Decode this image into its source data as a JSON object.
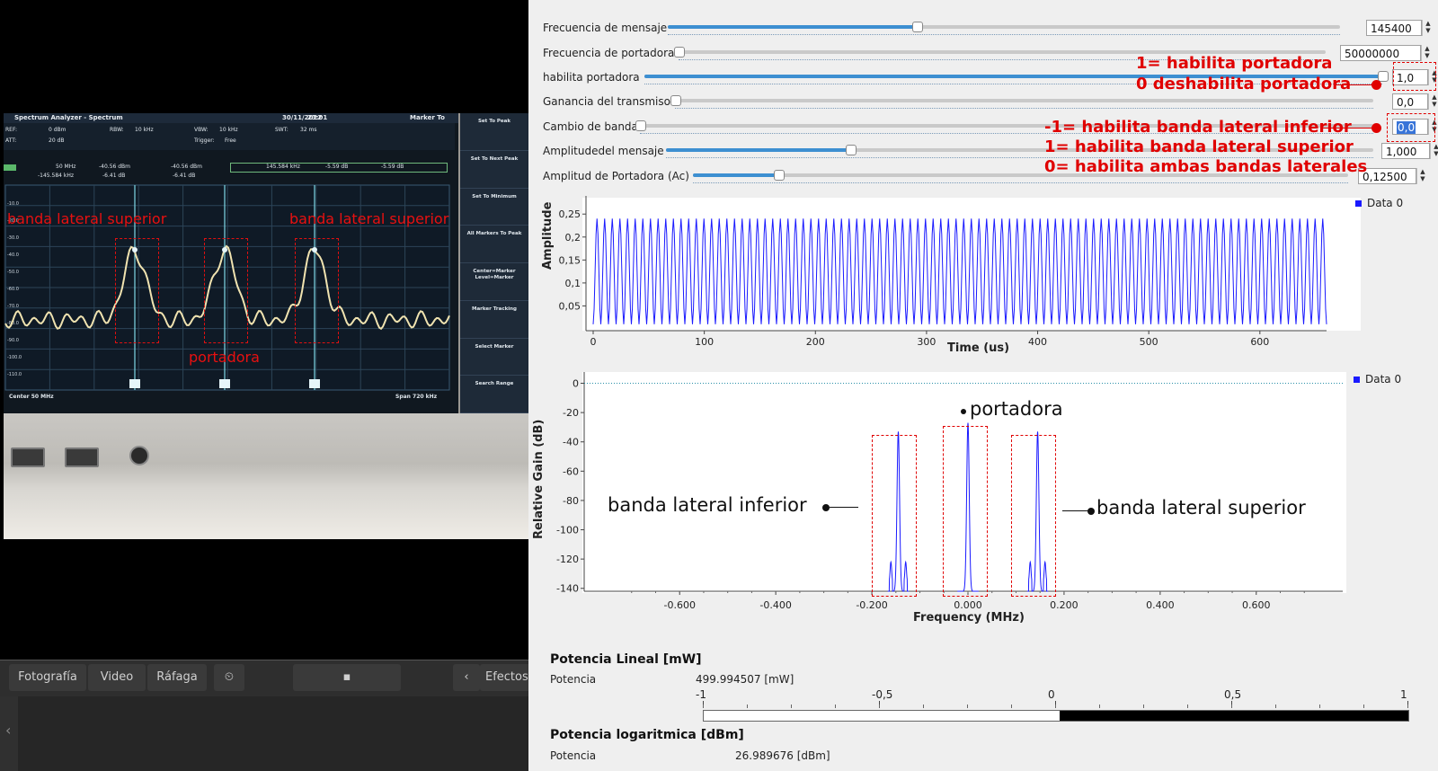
{
  "camera": {
    "analyzer": {
      "title": "Spectrum Analyzer - Spectrum",
      "date": "30/11/2022",
      "time": "23:01",
      "marker_to": "Marker To",
      "ref_label": "REF:",
      "ref_value": "0 dBm",
      "att_label": "ATT:",
      "att_value": "20 dB",
      "rbw_label": "RBW:",
      "rbw_value": "10 kHz",
      "vbw_label": "VBW:",
      "vbw_value": "10 kHz",
      "swt_label": "SWT:",
      "swt_value": "32 ms",
      "trigger_label": "Trigger:",
      "trigger_value": "Free",
      "m1_freq": "50 MHz",
      "m1_level": "-40.56 dBm",
      "m1_delta_freq": "-145.584 kHz",
      "m1_delta_level": "-6.41 dB",
      "m2_level": "-40.56 dBm",
      "m2_delta": "-6.41 dB",
      "m3_freq": "145.584 kHz",
      "m3_level": "-5.59 dB",
      "m3_level2": "-5.59 dB",
      "y_ticks": [
        "-10.0",
        "-20.0",
        "-30.0",
        "-40.0",
        "-50.0",
        "-60.0",
        "-70.0",
        "-80.0",
        "-90.0",
        "-100.0",
        "-110.0"
      ],
      "center": "Center 50 MHz",
      "span": "Span 720 kHz",
      "softkeys": [
        "Set To Peak",
        "Set To Next Peak",
        "Set To Minimum",
        "All Markers To Peak",
        "Center=Marker Level=Marker",
        "Marker Tracking",
        "Select Marker",
        "Search Range"
      ]
    },
    "annotations": {
      "left_sideband": "banda lateral superior",
      "right_sideband": "banda lateral superior",
      "carrier": "portadora"
    },
    "toolbar": {
      "photo": "Fotografía",
      "video": "Video",
      "burst": "Ráfaga",
      "effects": "Efectos"
    }
  },
  "controls": [
    {
      "label": "Frecuencia de mensaje",
      "value": "145400",
      "level": 0.37
    },
    {
      "label": "Frecuencia de portadora",
      "value": "50000000",
      "level": 0.0
    },
    {
      "label": "habilita portadora",
      "value": "1,0",
      "level": 1.0
    },
    {
      "label": "Ganancia del transmisor",
      "value": "0,0",
      "level": 0.0
    },
    {
      "label": "Cambio de banda",
      "value": "0,0",
      "level": 0.0
    },
    {
      "label": "Amplitudedel mensaje",
      "value": "1,000",
      "level": 0.26
    },
    {
      "label": "Amplitud de Portadora (Ac)",
      "value": "0,12500",
      "level": 0.13
    }
  ],
  "control_annotations": {
    "carrier_on": "1= habilita portadora",
    "carrier_off": "0 deshabilita portadora",
    "band_lower": "-1= habilita banda lateral inferior",
    "band_upper": "1= habilita banda lateral superior",
    "band_both": "0= habilita ambas bandas laterales"
  },
  "chart_data": [
    {
      "type": "line",
      "ylabel": "Amplitude",
      "xlabel": "Time (us)",
      "x_ticks": [
        "0",
        "100",
        "200",
        "300",
        "400",
        "500",
        "600"
      ],
      "y_ticks": [
        "0,05",
        "0,1",
        "0,15",
        "0,2",
        "0,25"
      ],
      "xlim": [
        0,
        660
      ],
      "ylim": [
        0,
        0.27
      ],
      "series": [
        {
          "name": "Data 0",
          "color": "#1a1aff",
          "waveform": "sine",
          "amplitude_range": [
            0.01,
            0.24
          ],
          "cycles": 96
        }
      ],
      "grid": false,
      "legend": "top-right"
    },
    {
      "type": "line",
      "ylabel": "Relative Gain (dB)",
      "xlabel": "Frequency (MHz)",
      "x_ticks": [
        "-0.600",
        "-0.400",
        "-0.200",
        "0.000",
        "0.200",
        "0.400",
        "0.600"
      ],
      "y_ticks": [
        "0",
        "-20",
        "-40",
        "-60",
        "-80",
        "-100",
        "-120",
        "-140"
      ],
      "xlim": [
        -0.78,
        0.78
      ],
      "ylim": [
        -142,
        4
      ],
      "reference_line_db": 0,
      "series": [
        {
          "name": "Data 0",
          "color": "#1a1aff",
          "peaks": [
            {
              "x": -0.145,
              "y": -33
            },
            {
              "x": 0.0,
              "y": -27
            },
            {
              "x": 0.145,
              "y": -33
            }
          ]
        }
      ],
      "grid": false,
      "legend": "top-right"
    }
  ],
  "spectrum_annotations": {
    "carrier": "portadora",
    "lower": "banda lateral inferior",
    "upper": "banda lateral superior"
  },
  "power": {
    "linear_title": "Potencia Lineal [mW]",
    "linear_label": "Potencia",
    "linear_value": "499.994507 [mW]",
    "bar_ticks": [
      "-1",
      "-0,5",
      "0",
      "0,5",
      "1"
    ],
    "bar_level": 1.0,
    "log_title": "Potencia logaritmica [dBm]",
    "log_label": "Potencia",
    "log_value": "26.989676 [dBm]"
  }
}
